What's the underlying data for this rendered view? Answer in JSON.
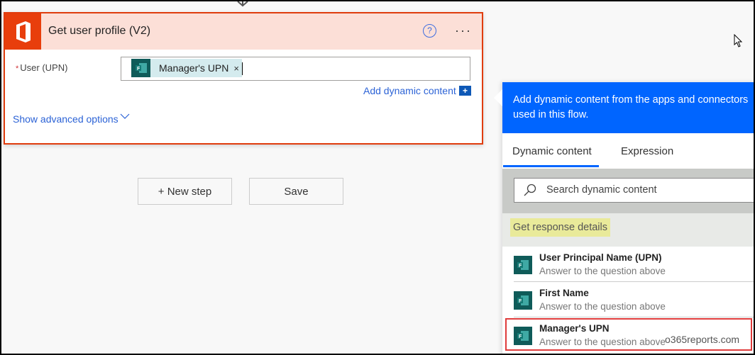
{
  "action_card": {
    "title": "Get user profile (V2)",
    "icon": "office-365-logo",
    "help_icon": "question-circle-icon",
    "more_icon": "ellipsis-icon",
    "field": {
      "required_marker": "*",
      "label": "User (UPN)",
      "token_label": "Manager's UPN",
      "token_remove": "×"
    },
    "add_dynamic_content": "Add dynamic content",
    "add_dynamic_button": "+",
    "show_advanced": "Show advanced options"
  },
  "buttons": {
    "new_step": "+ New step",
    "save": "Save"
  },
  "dynamic_panel": {
    "header": "Add dynamic content from the apps and connectors used in this flow.",
    "tabs": [
      {
        "label": "Dynamic content",
        "active": true
      },
      {
        "label": "Expression",
        "active": false
      }
    ],
    "search_placeholder": "Search dynamic content",
    "group_label": "Get response details",
    "items": [
      {
        "title": "User Principal Name (UPN)",
        "subtitle": "Answer to the question above"
      },
      {
        "title": "First Name",
        "subtitle": "Answer to the question above"
      },
      {
        "title": "Manager's UPN",
        "subtitle": "Answer to the question above",
        "highlighted": true
      }
    ]
  },
  "watermark": "o365reports.com",
  "colors": {
    "accent_blue": "#0065ff",
    "office_orange": "#e83e0c",
    "card_border": "#e03c0d",
    "forms_teal": "#0f5b59"
  }
}
